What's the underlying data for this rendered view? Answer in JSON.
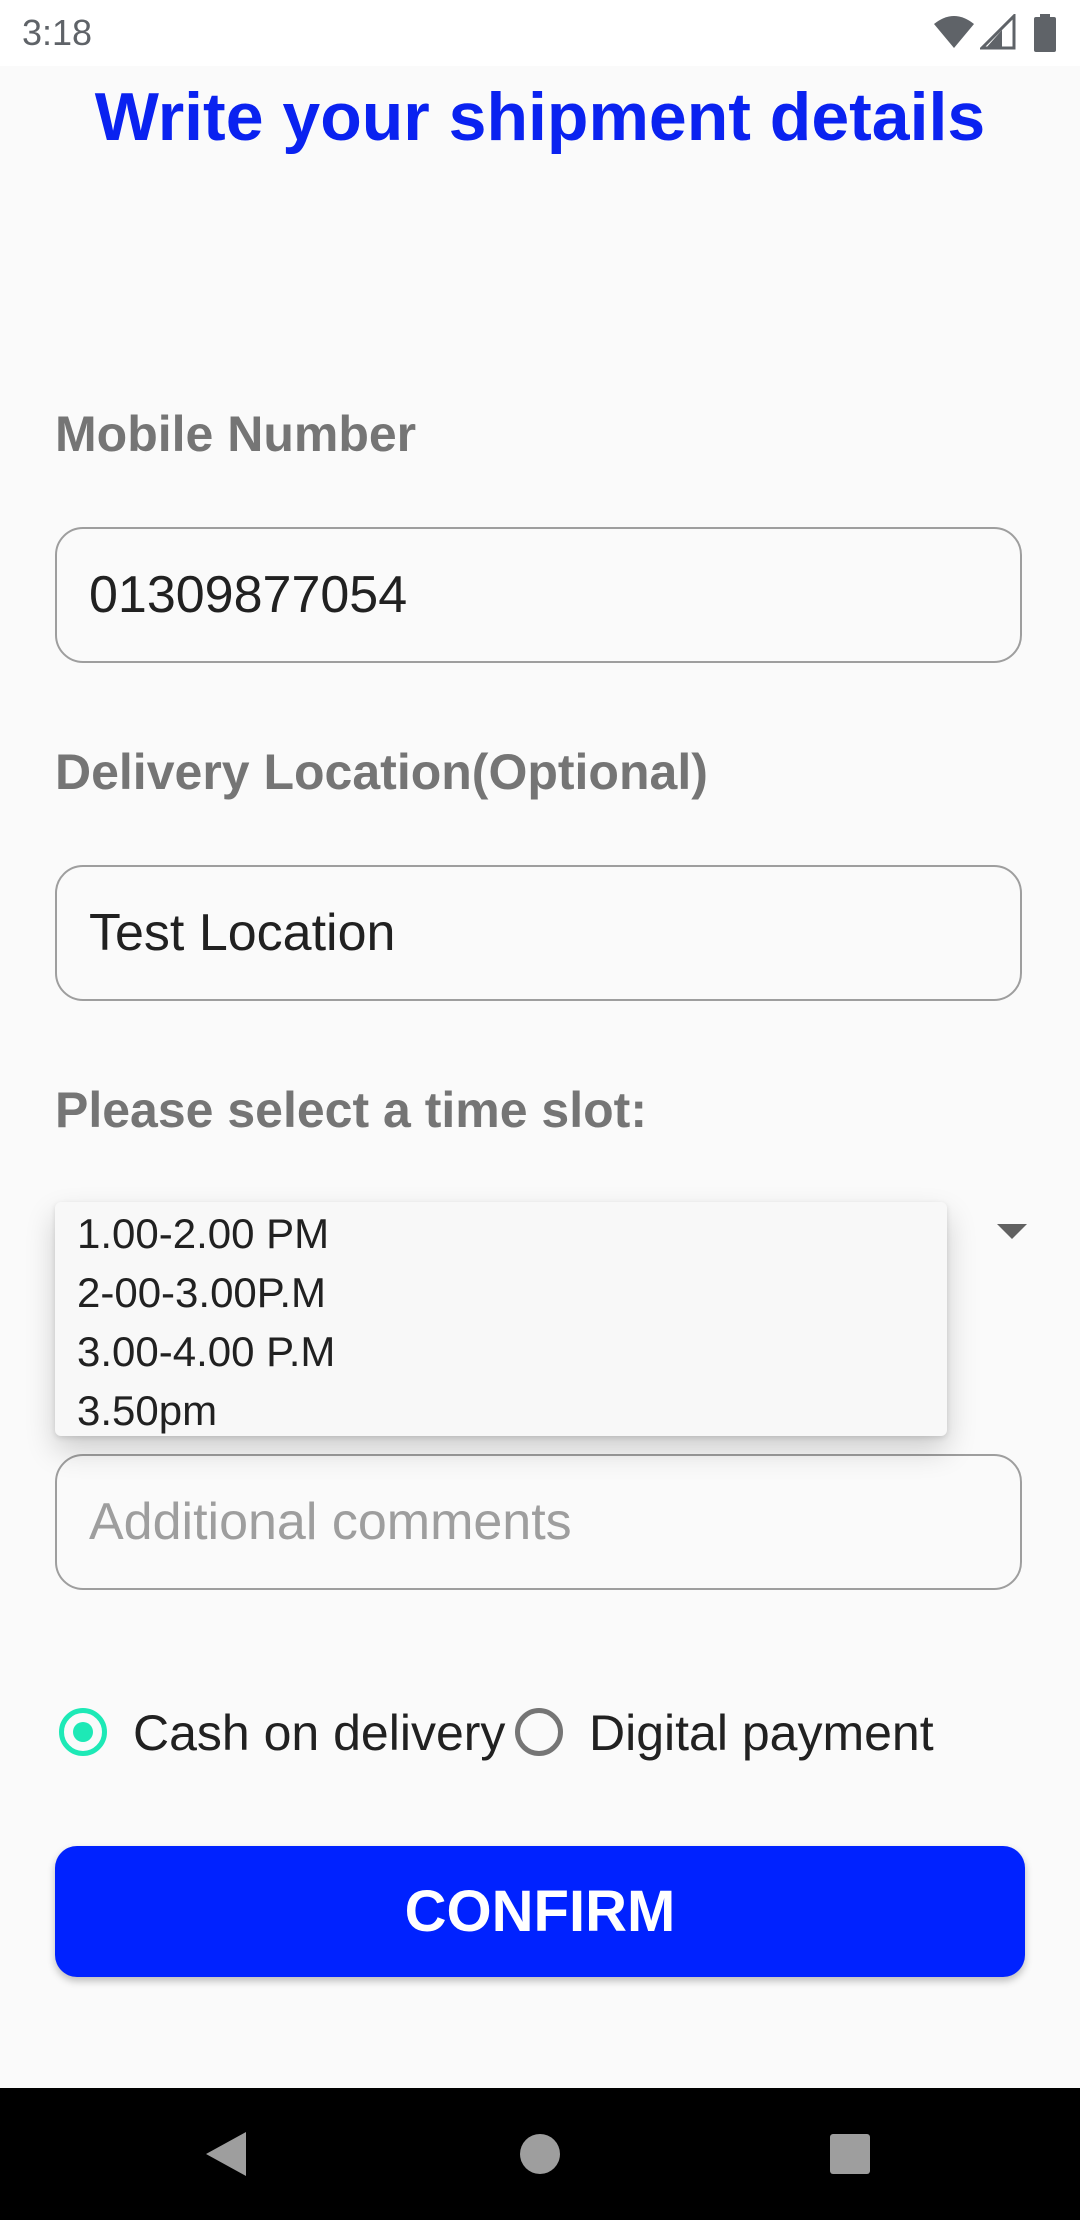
{
  "status_bar": {
    "time": "3:18",
    "icons": [
      "wifi-icon",
      "signal-icon",
      "battery-icon"
    ]
  },
  "page": {
    "title": "Write your shipment details"
  },
  "form": {
    "mobile_label": "Mobile Number",
    "mobile_value": "01309877054",
    "location_label": "Delivery Location(Optional)",
    "location_value": "Test Location",
    "time_slot_label": "Please select a time slot:",
    "time_slot_options": [
      "1.00-2.00 PM",
      "2-00-3.00P.M",
      "3.00-4.00 P.M",
      "3.50pm"
    ],
    "comments_placeholder": "Additional comments",
    "payment": {
      "options": [
        "Cash on delivery",
        "Digital payment"
      ],
      "selected": "Cash on delivery"
    },
    "confirm_label": "CONFIRM"
  },
  "colors": {
    "title": "#0a22f0",
    "button": "#0022ff",
    "radio_accent": "#1de9b6"
  },
  "nav_bar": {
    "icons": [
      "back-icon",
      "home-icon",
      "recents-icon"
    ]
  }
}
